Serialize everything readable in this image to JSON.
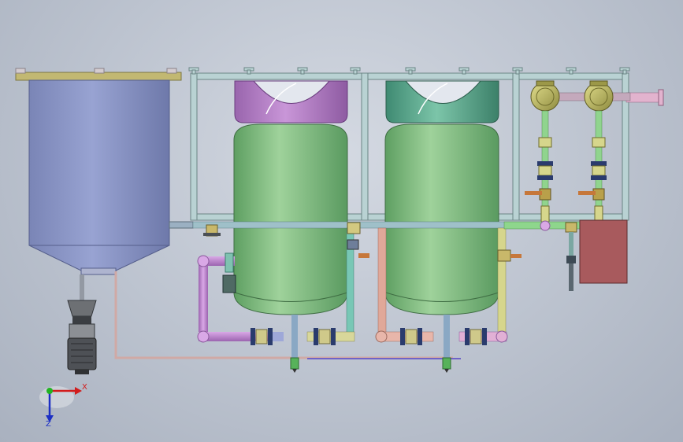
{
  "scene": {
    "colors": {
      "background": "#bcc3cf",
      "frame": "#b9d2d3",
      "storage_tank": "#8b96c6",
      "tank_green_dark": "#5da768",
      "tank_green_light": "#9fd29b",
      "tank_top_violet": "#b37ec6",
      "tank_top_teal": "#5aa98f",
      "pipe_violet": "#b57ec7",
      "pipe_teal": "#78c7b5",
      "pipe_peach": "#e0a899",
      "pipe_yellow": "#d6d68c",
      "pipe_green": "#8ed68c",
      "flange_navy": "#2a3b6d",
      "pump_gray": "#6d7074",
      "control_box": "#a85a5d",
      "valve_handle": "#c6773a",
      "meter_gold": "#b6b35c"
    }
  },
  "axes": {
    "x_label": "X",
    "z_label": "Z",
    "x_color": "#d21c1c",
    "y_color": "#22b322",
    "z_color": "#1c2fc4"
  }
}
